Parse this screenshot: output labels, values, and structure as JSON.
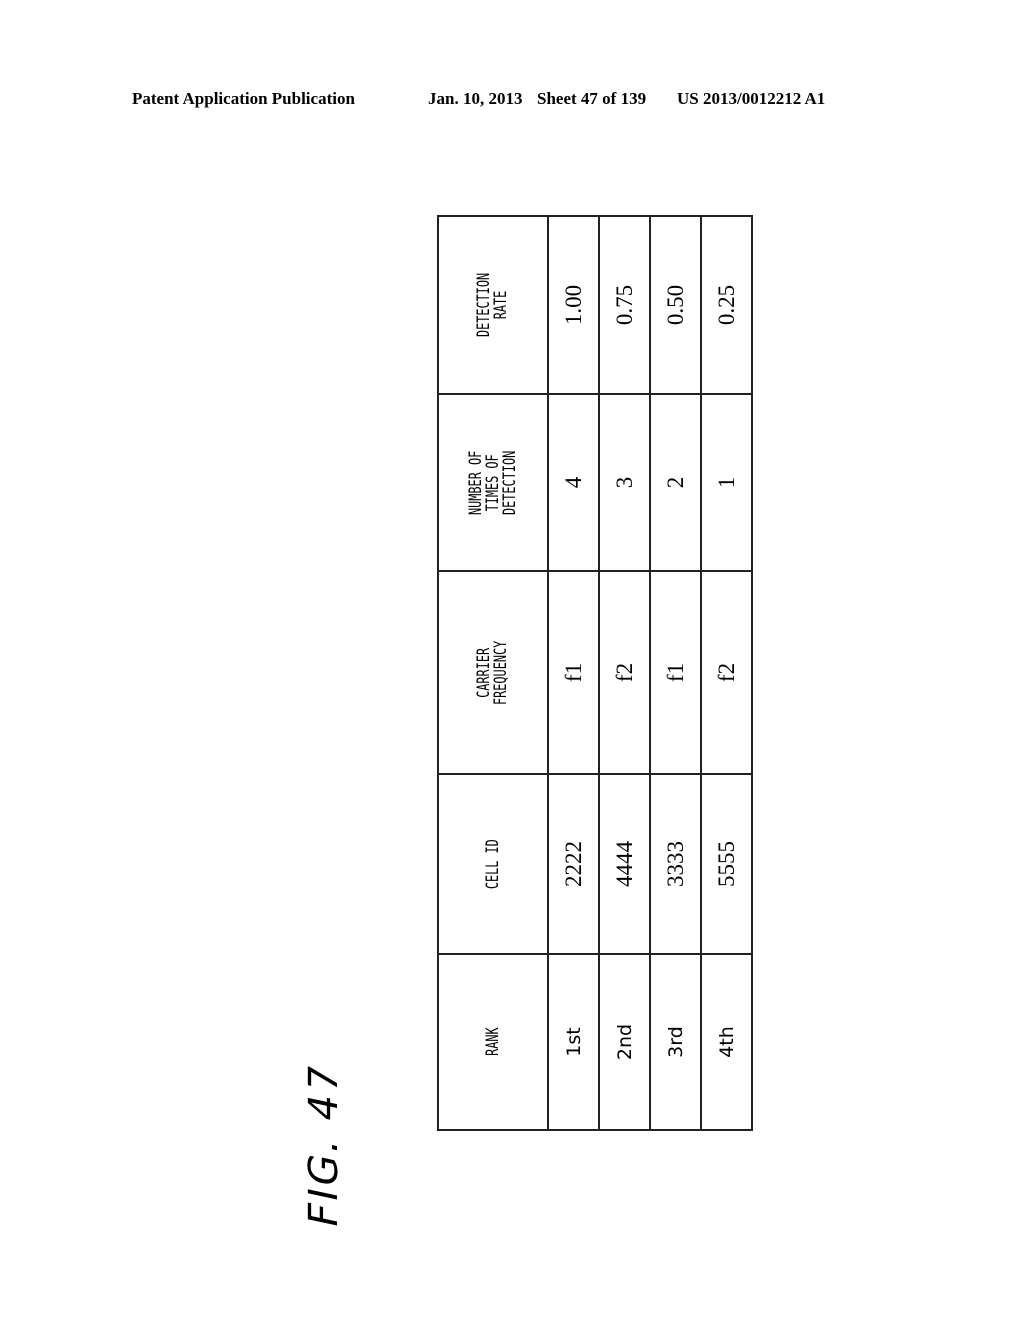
{
  "header": {
    "publication": "Patent Application Publication",
    "date": "Jan. 10, 2013",
    "sheet": "Sheet 47 of 139",
    "number": "US 2013/0012212 A1"
  },
  "figure": {
    "label": "FIG. 47"
  },
  "table": {
    "columns": [
      {
        "lines": [
          "RANK"
        ]
      },
      {
        "lines": [
          "CELL ID"
        ]
      },
      {
        "lines": [
          "CARRIER",
          "FREQUENCY"
        ]
      },
      {
        "lines": [
          "NUMBER OF",
          "TIMES OF",
          "DETECTION"
        ]
      },
      {
        "lines": [
          "DETECTION",
          "RATE"
        ]
      }
    ],
    "rows": [
      {
        "rank": "1st",
        "cell_id": "2222",
        "carrier_frequency": "f1",
        "times": "4",
        "rate": "1.00"
      },
      {
        "rank": "2nd",
        "cell_id": "4444",
        "carrier_frequency": "f2",
        "times": "3",
        "rate": "0.75"
      },
      {
        "rank": "3rd",
        "cell_id": "3333",
        "carrier_frequency": "f1",
        "times": "2",
        "rate": "0.50"
      },
      {
        "rank": "4th",
        "cell_id": "5555",
        "carrier_frequency": "f2",
        "times": "1",
        "rate": "0.25"
      }
    ]
  }
}
